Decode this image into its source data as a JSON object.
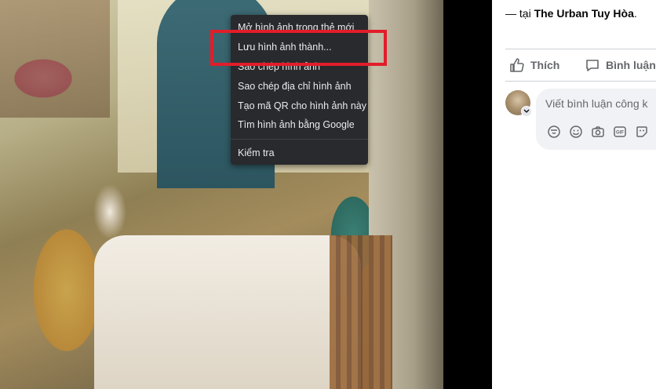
{
  "post": {
    "location_prefix": "— tại ",
    "location_name": "The Urban Tuy Hòa",
    "location_suffix": "."
  },
  "actions": {
    "like_label": "Thích",
    "comment_label": "Bình luận"
  },
  "comment_box": {
    "placeholder": "Viết bình luận công k"
  },
  "comment_tools": [
    "avatar-sticker-icon",
    "emoji-icon",
    "camera-icon",
    "gif-icon",
    "sticker-icon"
  ],
  "context_menu": {
    "items": [
      "Mở hình ảnh trong thẻ mới",
      "Lưu hình ảnh thành...",
      "Sao chép hình ảnh",
      "Sao chép địa chỉ hình ảnh",
      "Tạo mã QR cho hình ảnh này",
      "Tìm hình ảnh bằng Google",
      "Kiểm tra"
    ],
    "highlighted_item": "Lưu hình ảnh thành..."
  },
  "colors": {
    "highlight_border": "#e21d2a",
    "menu_background": "#292a2d",
    "menu_text": "#e8eaed",
    "panel_background": "#ffffff"
  }
}
